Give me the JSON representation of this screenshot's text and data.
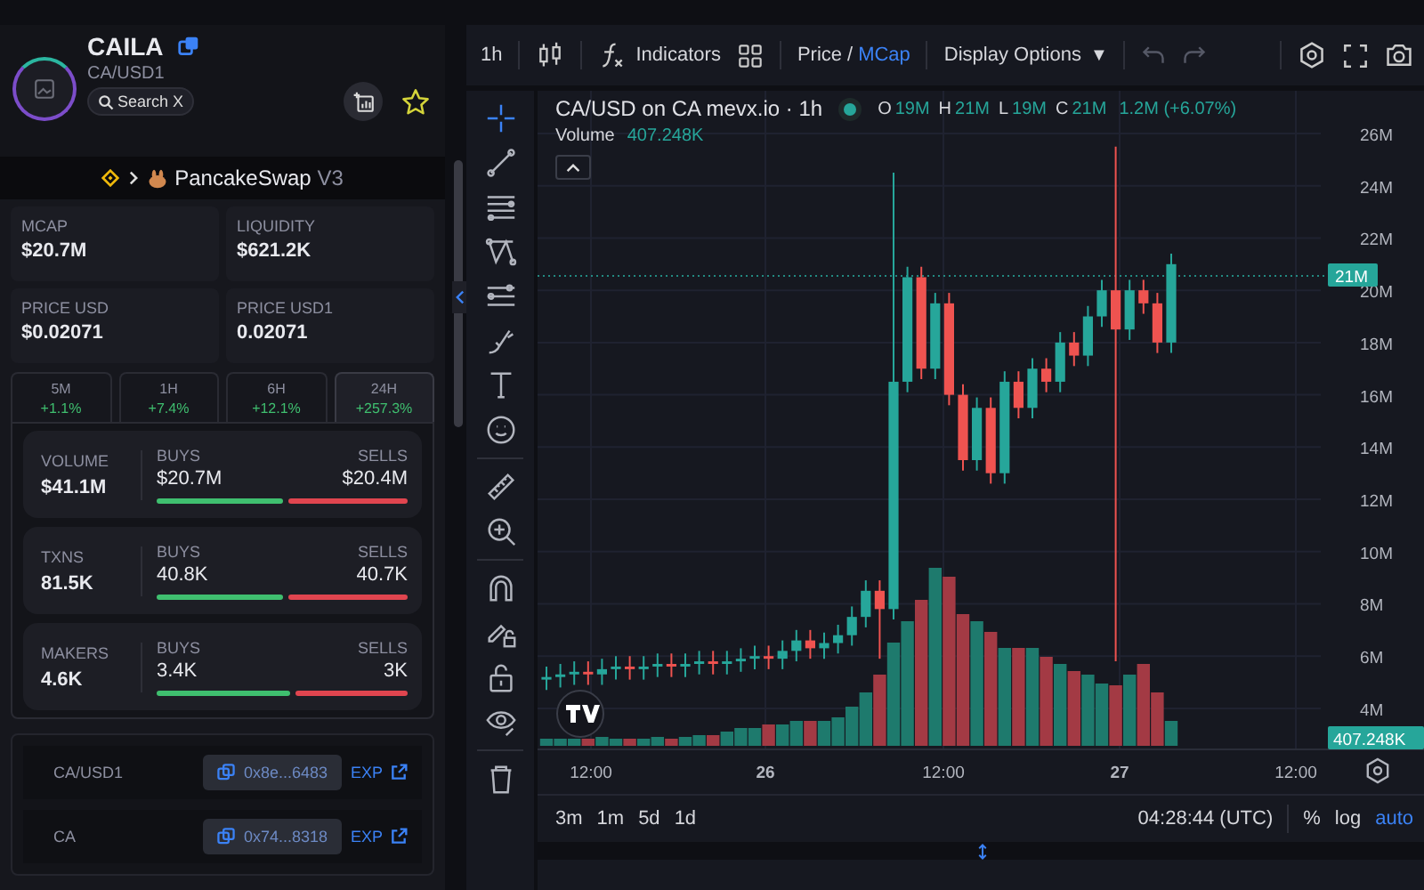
{
  "token": {
    "name": "CAILA",
    "pair": "CA/USD1",
    "search": "Search X"
  },
  "dex": {
    "name": "PancakeSwap",
    "version": "V3"
  },
  "stats": [
    {
      "label": "MCAP",
      "value": "$20.7M"
    },
    {
      "label": "LIQUIDITY",
      "value": "$621.2K"
    },
    {
      "label": "PRICE USD",
      "value": "$0.02071"
    },
    {
      "label": "PRICE USD1",
      "value": "0.02071"
    }
  ],
  "timeframes": [
    {
      "label": "5M",
      "change": "+1.1%",
      "selected": false
    },
    {
      "label": "1H",
      "change": "+7.4%",
      "selected": false
    },
    {
      "label": "6H",
      "change": "+12.1%",
      "selected": false
    },
    {
      "label": "24H",
      "change": "+257.3%",
      "selected": true
    }
  ],
  "activity": [
    {
      "label": "VOLUME",
      "total": "$41.1M",
      "buys_label": "BUYS",
      "buys": "$20.7M",
      "sells_label": "SELLS",
      "sells": "$20.4M",
      "level": 0.5
    },
    {
      "label": "TXNS",
      "total": "81.5K",
      "buys_label": "BUYS",
      "buys": "40.8K",
      "sells_label": "SELLS",
      "sells": "40.7K",
      "level": 0.5
    },
    {
      "label": "MAKERS",
      "total": "4.6K",
      "buys_label": "BUYS",
      "buys": "3.4K",
      "sells_label": "SELLS",
      "sells": "3K",
      "level": 0.53
    }
  ],
  "addresses": [
    {
      "label": "CA/USD1",
      "address": "0x8e...6483",
      "link": "EXP"
    },
    {
      "label": "CA",
      "address": "0x74...8318",
      "link": "EXP"
    }
  ],
  "toolbar": {
    "interval": "1h",
    "indicators": "Indicators",
    "modes": [
      {
        "label": "Price",
        "selected": false
      },
      {
        "label": "MCap",
        "selected": true
      }
    ],
    "mode_separator": "/",
    "display_options": "Display Options",
    "display_arrow": "▼"
  },
  "drawing_tools": [
    {
      "kind": "crosshair",
      "selected": true
    },
    {
      "kind": "trend-line",
      "selected": false
    },
    {
      "kind": "fib",
      "selected": false
    },
    {
      "kind": "pattern",
      "selected": false
    },
    {
      "kind": "channel",
      "selected": false
    },
    {
      "kind": "brush",
      "selected": false
    },
    {
      "kind": "text",
      "selected": false
    },
    {
      "kind": "emoji",
      "selected": false
    },
    {
      "kind": "ruler",
      "selected": false
    },
    {
      "kind": "zoom",
      "selected": false
    },
    {
      "kind": "magnet",
      "selected": false
    },
    {
      "kind": "lock-drawing",
      "selected": false
    },
    {
      "kind": "unlock",
      "selected": false
    },
    {
      "kind": "eye",
      "selected": false
    },
    {
      "kind": "trash",
      "selected": false
    }
  ],
  "legend": {
    "title": "CA/USD on CA mevx.io · 1h",
    "ohlc": [
      {
        "key": "O",
        "value": "19M"
      },
      {
        "key": "H",
        "value": "21M"
      },
      {
        "key": "L",
        "value": "19M"
      },
      {
        "key": "C",
        "value": "21M"
      }
    ],
    "change": "1.2M (+6.07%)",
    "volume_label": "Volume",
    "volume_value": "407.248K"
  },
  "y_labels": [
    "26M",
    "24M",
    "22M",
    "20M",
    "18M",
    "16M",
    "14M",
    "12M",
    "10M",
    "8M",
    "6M",
    "4M"
  ],
  "price_tag": "21M",
  "volume_tag": "407.248K",
  "x_labels": [
    {
      "label": "12:00",
      "bold": false
    },
    {
      "label": "26",
      "bold": true
    },
    {
      "label": "12:00",
      "bold": false
    },
    {
      "label": "27",
      "bold": true
    },
    {
      "label": "12:00",
      "bold": false
    }
  ],
  "ranges": [
    "3m",
    "1m",
    "5d",
    "1d"
  ],
  "clock": "04:28:44 (UTC)",
  "scale_options": [
    {
      "label": "%",
      "selected": false
    },
    {
      "label": "log",
      "selected": false
    },
    {
      "label": "auto",
      "selected": true
    }
  ]
}
